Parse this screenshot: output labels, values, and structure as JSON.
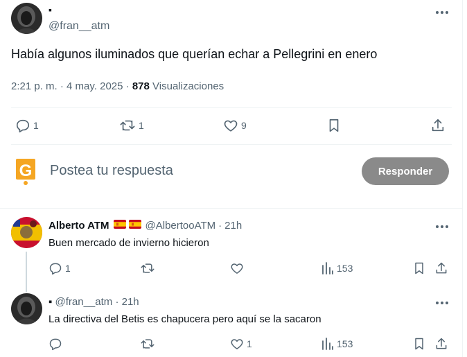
{
  "main_post": {
    "display_name": "▪",
    "handle": "@fran__atm",
    "text": "Había algunos iluminados que querían echar a Pellegrini en enero",
    "time": "2:21 p. m.",
    "date": "4 may. 2025",
    "sep1": "·",
    "sep2": "·",
    "views_count": "878",
    "views_label": "Visualizaciones",
    "replies": "1",
    "reposts": "1",
    "likes": "9"
  },
  "compose": {
    "placeholder": "Postea tu respuesta",
    "button": "Responder",
    "logo_letter": "G"
  },
  "replies": [
    {
      "display_name": "Alberto ATM",
      "handle": "@AlbertooATM",
      "sep": "·",
      "time": "21h",
      "text": "Buen mercado de invierno hicieron",
      "replies": "1",
      "reposts": "",
      "likes": "",
      "views": "153"
    },
    {
      "display_name": "▪",
      "handle": "@fran__atm",
      "sep": "·",
      "time": "21h",
      "text": "La directiva del Betis es chapucera pero aquí se la sacaron",
      "replies": "",
      "reposts": "",
      "likes": "1",
      "views": "153"
    }
  ],
  "colors": {
    "text": "#0f1419",
    "secondary": "#536471",
    "divider": "#eff3f4",
    "button_bg": "#8a8a8a",
    "logo_orange": "#f5a623"
  }
}
